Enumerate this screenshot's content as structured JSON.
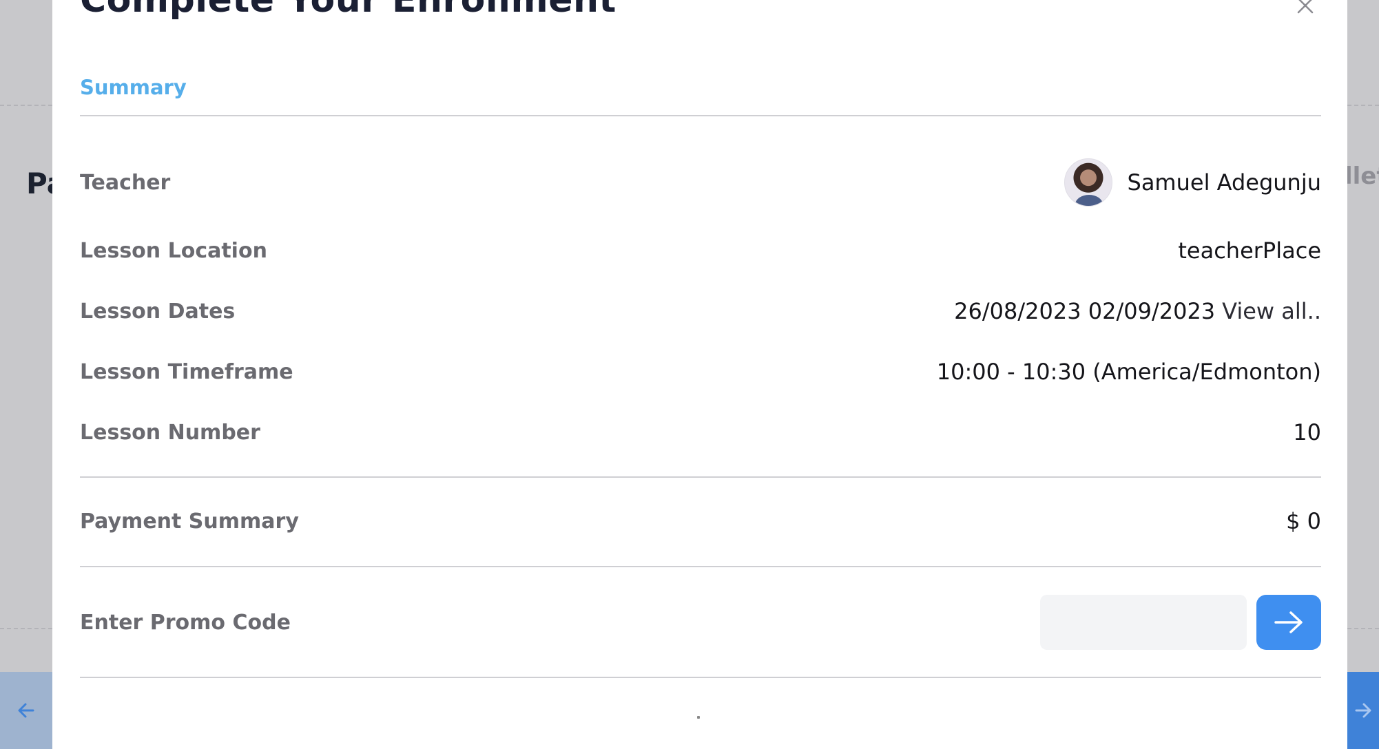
{
  "background": {
    "left_text": "Pa",
    "right_text": "llet"
  },
  "modal": {
    "title": "Complete Your Enrollment",
    "tab_label": "Summary",
    "rows": [
      {
        "label": "Teacher",
        "value": "Samuel Adegunju"
      },
      {
        "label": "Lesson Location",
        "value": "teacherPlace"
      },
      {
        "label": "Lesson Dates",
        "value": "26/08/2023 02/09/2023",
        "link": "View all.."
      },
      {
        "label": "Lesson Timeframe",
        "value": "10:00 - 10:30 (America/Edmonton)"
      },
      {
        "label": "Lesson Number",
        "value": "10"
      }
    ],
    "payment": {
      "label": "Payment Summary",
      "value": "$ 0"
    },
    "promo": {
      "label": "Enter Promo Code",
      "placeholder": "",
      "value": ""
    }
  },
  "colors": {
    "accent": "#56aeea",
    "button": "#3f8ff0",
    "title": "#1a1f33"
  },
  "icons": {
    "close": "close-icon",
    "submit": "arrow-right-icon",
    "nav_prev": "arrow-left-icon",
    "nav_next": "arrow-right-icon"
  }
}
